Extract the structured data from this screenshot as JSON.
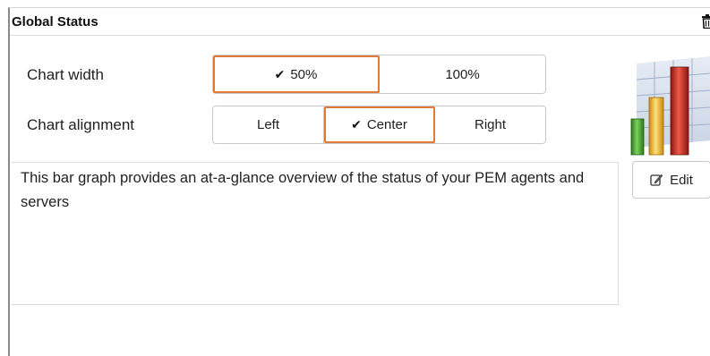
{
  "header": {
    "title": "Global Status",
    "delete_icon": "trash-icon"
  },
  "chart_width": {
    "label": "Chart width",
    "options": [
      "50%",
      "100%"
    ],
    "selected": "50%"
  },
  "chart_alignment": {
    "label": "Chart alignment",
    "options": [
      "Left",
      "Center",
      "Right"
    ],
    "selected": "Center"
  },
  "chart_icon": "bar-chart-icon",
  "description": {
    "text": "This bar graph provides an at-a-glance overview of the status of your PEM agents and servers"
  },
  "edit_button": {
    "label": "Edit",
    "icon": "edit-icon"
  },
  "colors": {
    "active_outline": "#e07a3a",
    "bar_green": "#3a9a2a",
    "bar_yellow": "#e8b020",
    "bar_red": "#c0281c"
  }
}
